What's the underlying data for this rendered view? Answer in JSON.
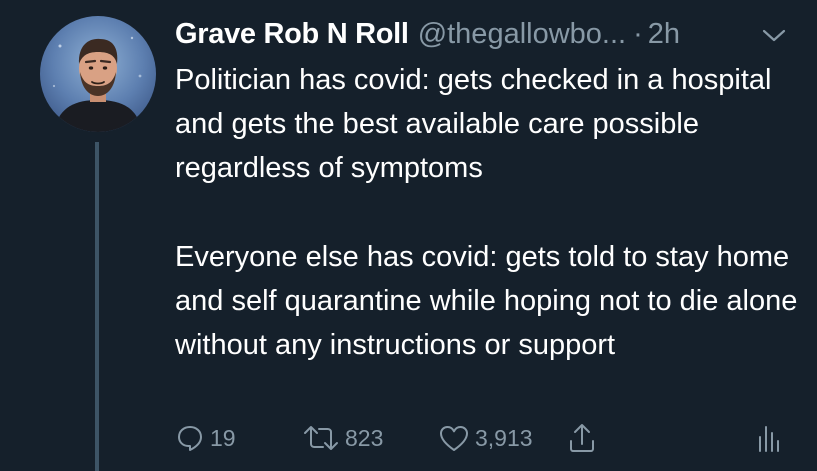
{
  "tweet": {
    "author": {
      "display_name": "Grave Rob N Roll",
      "handle": "@thegallowbo...",
      "avatar_icon": "user-avatar-photo"
    },
    "separator": "·",
    "time": "2h",
    "menu_icon": "chevron-down-icon",
    "paragraphs": [
      "Politician has covid: gets checked in a hospital and gets the best available care possible regardless of symptoms",
      "Everyone else has covid: gets told to stay home and self quarantine while hoping not to die alone without any instructions or support"
    ],
    "actions": {
      "reply_count": "19",
      "retweet_count": "823",
      "like_count": "3,913",
      "share_icon": "share-icon",
      "stats_icon": "analytics-icon"
    }
  },
  "colors": {
    "background": "#15202b",
    "text_primary": "#ffffff",
    "text_secondary": "#8899a6",
    "thread_line": "#3d5466"
  }
}
